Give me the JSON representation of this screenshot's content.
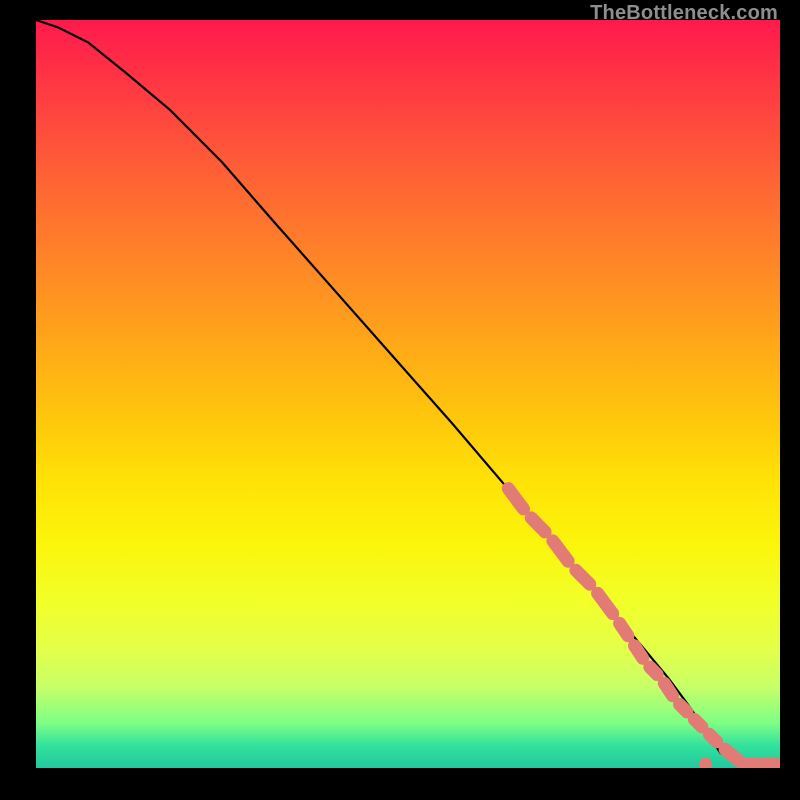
{
  "attribution": "TheBottleneck.com",
  "chart_data": {
    "type": "line",
    "title": "",
    "xlabel": "",
    "ylabel": "",
    "xlim": [
      0,
      100
    ],
    "ylim": [
      0,
      100
    ],
    "grid": false,
    "legend": false,
    "background_gradient": {
      "direction": "vertical",
      "stops": [
        {
          "pos": 0,
          "color": "#ff1a4e"
        },
        {
          "pos": 0.5,
          "color": "#ffc400"
        },
        {
          "pos": 0.8,
          "color": "#f1ff2a"
        },
        {
          "pos": 1.0,
          "color": "#21c89d"
        }
      ]
    },
    "series": [
      {
        "name": "bottleneck-curve",
        "color": "#000000",
        "style": "solid",
        "x": [
          0,
          3,
          7,
          12,
          18,
          25,
          32,
          40,
          48,
          56,
          62,
          68,
          74,
          80,
          85,
          88,
          90,
          92,
          95,
          100
        ],
        "y": [
          100,
          99,
          97,
          93,
          88,
          81,
          73,
          64,
          55,
          46,
          39,
          32,
          25,
          18,
          12,
          8,
          5,
          2,
          0.5,
          0.5
        ]
      },
      {
        "name": "highlight-segment",
        "color": "#e27a76",
        "style": "thick-dashed",
        "x": [
          63,
          66,
          69,
          72,
          75,
          78,
          80,
          82,
          84,
          86,
          88,
          90,
          92,
          95,
          97,
          100
        ],
        "y": [
          38,
          34,
          31,
          27,
          24,
          20,
          17,
          14,
          12,
          9,
          7,
          5,
          3,
          0.5,
          0.5,
          0.5
        ]
      }
    ]
  }
}
